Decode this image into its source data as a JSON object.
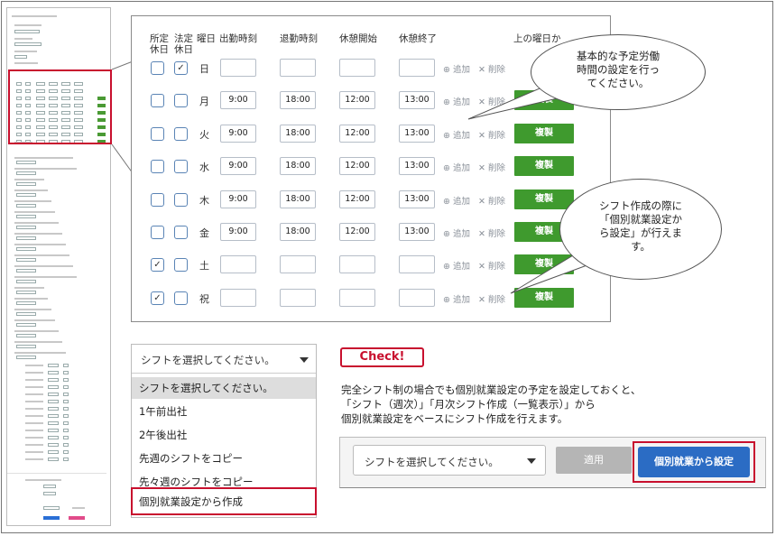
{
  "schedule": {
    "headers": {
      "fixed_holiday": [
        "所定",
        "休日"
      ],
      "legal_holiday": [
        "法定",
        "休日"
      ],
      "weekday": "曜日",
      "start": "出勤時刻",
      "end": "退勤時刻",
      "break_start": "休憩開始",
      "break_end": "休憩終了",
      "copy_above": "上の曜日か"
    },
    "add_label": "⊕ 追加",
    "delete_label": "✕ 削除",
    "copy_label": "複製",
    "rows": [
      {
        "day": "日",
        "fixed": false,
        "legal": true,
        "start": "",
        "end": "",
        "break_start": "",
        "break_end": "",
        "copy": false
      },
      {
        "day": "月",
        "fixed": false,
        "legal": false,
        "start": "9:00",
        "end": "18:00",
        "break_start": "12:00",
        "break_end": "13:00",
        "copy": true
      },
      {
        "day": "火",
        "fixed": false,
        "legal": false,
        "start": "9:00",
        "end": "18:00",
        "break_start": "12:00",
        "break_end": "13:00",
        "copy": true
      },
      {
        "day": "水",
        "fixed": false,
        "legal": false,
        "start": "9:00",
        "end": "18:00",
        "break_start": "12:00",
        "break_end": "13:00",
        "copy": true
      },
      {
        "day": "木",
        "fixed": false,
        "legal": false,
        "start": "9:00",
        "end": "18:00",
        "break_start": "12:00",
        "break_end": "13:00",
        "copy": true
      },
      {
        "day": "金",
        "fixed": false,
        "legal": false,
        "start": "9:00",
        "end": "18:00",
        "break_start": "12:00",
        "break_end": "13:00",
        "copy": true
      },
      {
        "day": "土",
        "fixed": true,
        "legal": false,
        "start": "",
        "end": "",
        "break_start": "",
        "break_end": "",
        "copy": true
      },
      {
        "day": "祝",
        "fixed": true,
        "legal": false,
        "start": "",
        "end": "",
        "break_start": "",
        "break_end": "",
        "copy": true
      }
    ]
  },
  "bubbles": {
    "top": [
      "基本的な予定労働",
      "時間の設定を行っ",
      "てください。"
    ],
    "bottom": [
      "シフト作成の際に",
      "「個別就業設定か",
      "ら設定」が行えま",
      "す。"
    ]
  },
  "dropdown": {
    "selected": "シフトを選択してください。",
    "options": [
      "シフトを選択してください。",
      "1午前出社",
      "2午後出社",
      "先週のシフトをコピー",
      "先々週のシフトをコピー",
      "個別就業設定から作成"
    ],
    "highlighted_index": 0,
    "boxed_index": 5
  },
  "check": {
    "badge": "Check!",
    "lines": [
      "完全シフト制の場合でも個別就業設定の予定を設定しておくと、",
      "「シフト（週次）」「月次シフト作成（一覧表示）」から",
      "個別就業設定をベースにシフト作成を行えます。"
    ]
  },
  "action_bar": {
    "select_text": "シフトを選択してください。",
    "apply_label": "適用",
    "individual_label": "個別就業から設定"
  },
  "colors": {
    "accent_red": "#c8102e",
    "copy_green": "#3f9a2e",
    "primary_blue": "#2b6cc4",
    "checkbox_border": "#5a84b5"
  }
}
